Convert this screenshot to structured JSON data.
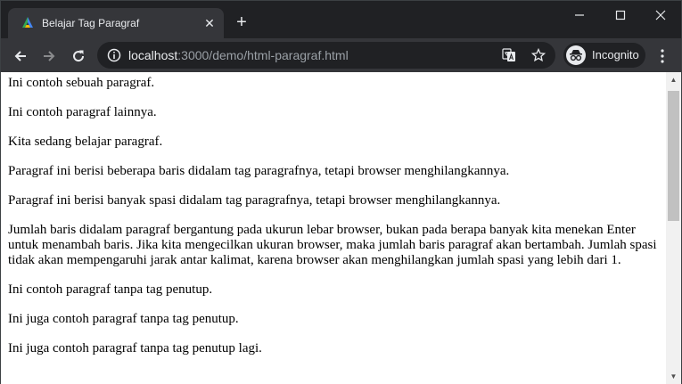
{
  "browser": {
    "tab_title": "Belajar Tag Paragraf",
    "close_tab_symbol": "✕",
    "new_tab_symbol": "+",
    "url_host": "localhost",
    "url_rest": ":3000/demo/html-paragraf.html",
    "incognito_label": "Incognito",
    "icons": [
      "favicon-icon",
      "close-icon",
      "plus-icon",
      "minimize-icon",
      "maximize-icon",
      "window-close-icon",
      "back-arrow-icon",
      "forward-arrow-icon",
      "reload-icon",
      "info-icon",
      "translate-icon",
      "star-icon",
      "incognito-icon",
      "kebab-menu-icon"
    ],
    "colors": {
      "frame": "#202124",
      "toolbar": "#35363a",
      "text": "#e8eaed",
      "url_dim": "#9aa0a6"
    }
  },
  "page": {
    "paragraphs": [
      "Ini contoh sebuah paragraf.",
      "Ini contoh paragraf lainnya.",
      "Kita sedang belajar paragraf.",
      "Paragraf ini berisi beberapa baris didalam tag paragrafnya, tetapi browser menghilangkannya.",
      "Paragraf ini berisi banyak spasi didalam tag paragrafnya, tetapi browser menghilangkannya.",
      "Jumlah baris didalam paragraf bergantung pada ukurun lebar browser, bukan pada berapa banyak kita menekan Enter untuk menambah baris. Jika kita mengecilkan ukuran browser, maka jumlah baris paragraf akan bertambah. Jumlah spasi tidak akan mempengaruhi jarak antar kalimat, karena browser akan menghilangkan jumlah spasi yang lebih dari 1.",
      "Ini contoh paragraf tanpa tag penutup.",
      "Ini juga contoh paragraf tanpa tag penutup.",
      "Ini juga contoh paragraf tanpa tag penutup lagi."
    ]
  }
}
